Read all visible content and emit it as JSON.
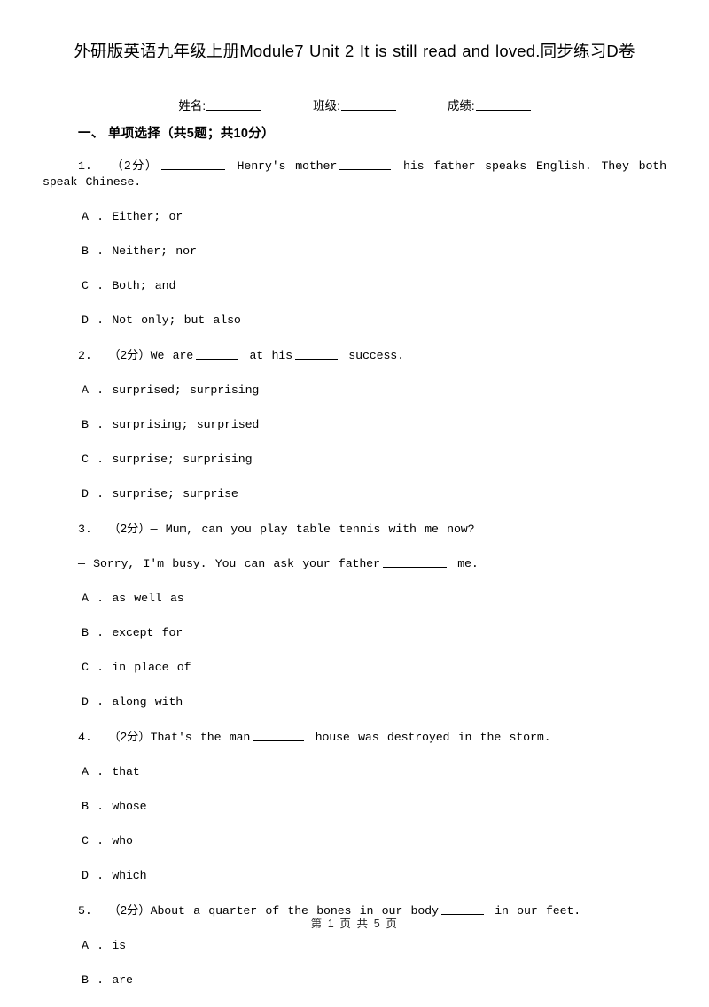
{
  "document": {
    "title": "外研版英语九年级上册Module7 Unit 2 It is still read and loved.同步练习D卷",
    "info": {
      "name_label": "姓名:",
      "class_label": "班级:",
      "score_label": "成绩:"
    },
    "footer": "第 1 页 共 5 页"
  },
  "sections": [
    {
      "heading": "一、 单项选择（共5题；共10分）"
    }
  ],
  "questions": [
    {
      "number": "1.",
      "points": "（2分）",
      "stem_part1": "",
      "stem_part2": "Henry's mother",
      "stem_part3": "his father speaks English. They both speak Chinese.",
      "options": [
        "A . Either; or",
        "B . Neither; nor",
        "C . Both; and",
        "D . Not only; but also"
      ]
    },
    {
      "number": "2.",
      "points": "（2分）",
      "stem_part1": "We are",
      "stem_part2": "at his",
      "stem_part3": "success.",
      "options": [
        "A . surprised; surprising",
        "B . surprising; surprised",
        "C . surprise; surprising",
        "D . surprise; surprise"
      ]
    },
    {
      "number": "3.",
      "points": "（2分）",
      "stem_line1": "— Mum, can you play table tennis with me now?",
      "stem_line2_a": "— Sorry, I'm busy. You can ask your father",
      "stem_line2_b": "me.",
      "options": [
        "A . as well as",
        "B . except for",
        "C . in place of",
        "D . along with"
      ]
    },
    {
      "number": "4.",
      "points": "（2分）",
      "stem_part1": "That's the man",
      "stem_part2": "house was destroyed in the storm.",
      "options": [
        "A . that",
        "B . whose",
        "C . who",
        "D . which"
      ]
    },
    {
      "number": "5.",
      "points": "（2分）",
      "stem_part1": "About a quarter of the bones in our body",
      "stem_part2": "in our feet.",
      "options": [
        "A . is",
        "B . are"
      ]
    }
  ]
}
